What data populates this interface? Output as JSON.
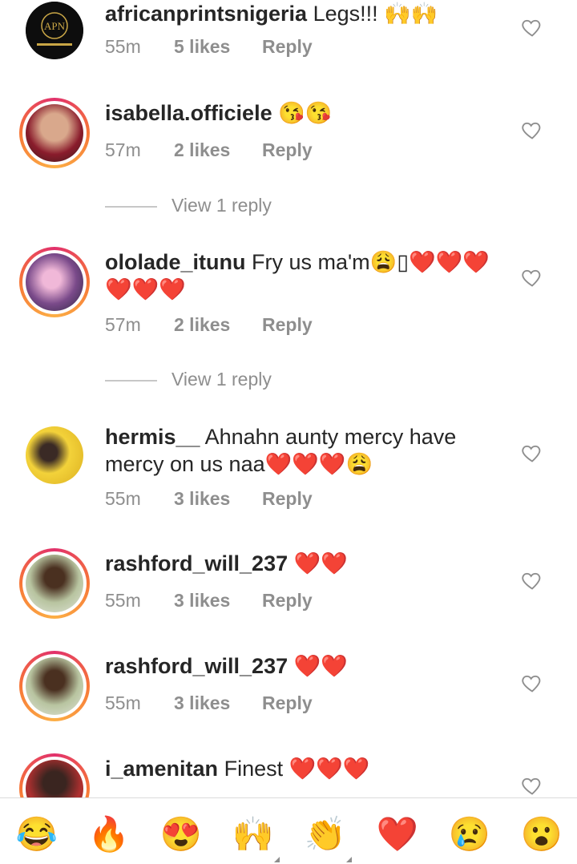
{
  "comments": [
    {
      "user": "africanprintsnigeria",
      "text": "Legs!!! 🙌🙌",
      "time": "55m",
      "likes": "5 likes",
      "reply": "Reply"
    },
    {
      "user": "isabella.officiele",
      "text": "😘😘",
      "time": "57m",
      "likes": "2 likes",
      "reply": "Reply",
      "view_replies": "View 1 reply"
    },
    {
      "user": "ololade_itunu",
      "text": "Fry us ma'm😩▯❤️❤️❤️❤️❤️❤️",
      "time": "57m",
      "likes": "2 likes",
      "reply": "Reply",
      "view_replies": "View 1 reply"
    },
    {
      "user": "hermis__",
      "text": "Ahnahn aunty mercy have mercy on us naa❤️❤️❤️😩",
      "time": "55m",
      "likes": "3 likes",
      "reply": "Reply"
    },
    {
      "user": "rashford_will_237",
      "text": "❤️❤️",
      "time": "55m",
      "likes": "3 likes",
      "reply": "Reply"
    },
    {
      "user": "rashford_will_237",
      "text": "❤️❤️",
      "time": "55m",
      "likes": "3 likes",
      "reply": "Reply"
    },
    {
      "user": "i_amenitan",
      "text": "Finest ❤️❤️❤️"
    }
  ],
  "logo_text": "APN",
  "emoji_bar": [
    "😂",
    "🔥",
    "😍",
    "🙌",
    "👏",
    "❤️",
    "😢",
    "😮"
  ],
  "colors": {
    "ring_gradient": [
      "#e1306c",
      "#f77737",
      "#fcaf45"
    ],
    "secondary_text": "#8e8e8e",
    "primary_text": "#262626"
  },
  "icons": {
    "like": "heart-outline-icon"
  }
}
